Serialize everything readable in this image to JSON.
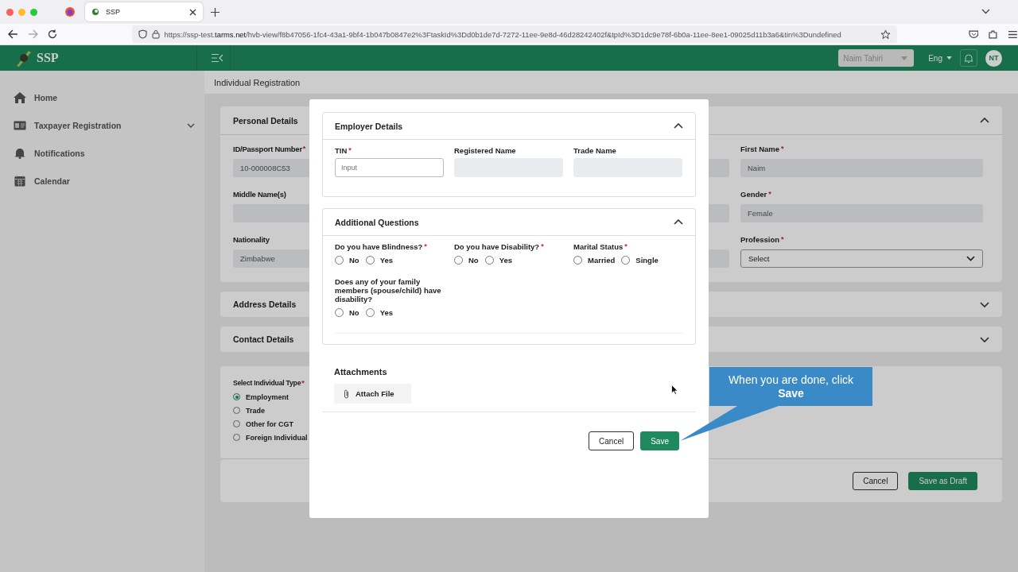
{
  "browser": {
    "tabs": [
      {
        "title": "SSP",
        "selected": true
      }
    ],
    "url": "https://ssp-test.**tarms.net**/hvb-view/f8b47056-1fc4-43a1-9bf4-1b047b0847e2%3FtaskId%3Dd0b1de7d-7272-11ee-9e8d-46d28242402f&tpId%3D1dc9e78f-6b0a-11ee-8ee1-09025d11b3a6&tin%3Dundefined"
  },
  "header": {
    "logo": "SSP",
    "user": "Naim Tahiri",
    "language": "Eng",
    "avatar": "NT"
  },
  "sidebar": {
    "items": [
      {
        "label": "Home"
      },
      {
        "label": "Taxpayer Registration",
        "expanded": false
      },
      {
        "label": "Notifications"
      },
      {
        "label": "Calendar"
      }
    ]
  },
  "page_title": "Individual Registration",
  "personal_details": {
    "title": "Personal Details",
    "expanded": true,
    "left_fields": [
      {
        "label": "ID/Passport Number",
        "required_mark": "*",
        "value": "10-000008C53",
        "kind": "text"
      },
      {
        "label": "Middle Name(s)",
        "kind": "text"
      },
      {
        "label": "Nationality",
        "value": "Zimbabwe",
        "kind": "text"
      }
    ],
    "right_fields": [
      {
        "label": "First Name",
        "required_mark": "*",
        "value": "Naim",
        "kind": "text"
      },
      {
        "label": "Gender",
        "required_mark": "*",
        "value": "Female",
        "kind": "text"
      },
      {
        "label": "Profession",
        "required_mark": "*",
        "value": "Select",
        "kind": "select"
      }
    ]
  },
  "collapsed_sections": [
    {
      "title": "Address Details",
      "expanded": false
    },
    {
      "title": "Contact Details",
      "expanded": false
    }
  ],
  "individual_type": {
    "label": "Select Individual Type",
    "required_mark": "*",
    "options": [
      {
        "label": "Employment",
        "selected": true
      },
      {
        "label": "Trade",
        "selected": false
      },
      {
        "label": "Other for CGT",
        "selected": false
      },
      {
        "label": "Foreign Individual",
        "selected": false
      }
    ]
  },
  "footer_buttons": [
    {
      "label": "Cancel",
      "kind": "secondary"
    },
    {
      "label": "Save as Draft",
      "kind": "primary"
    }
  ],
  "modal": {
    "employer_details": {
      "title": "Employer Details",
      "expanded": true,
      "fields": [
        {
          "label": "TIN",
          "required_mark": "*",
          "placeholder": "Input",
          "disabled": false
        },
        {
          "label": "Registered Name",
          "disabled": true
        },
        {
          "label": "Trade Name",
          "disabled": true
        }
      ]
    },
    "additional_questions": {
      "title": "Additional Questions",
      "expanded": true,
      "questions": [
        {
          "label": "Do you have Blindness?",
          "required_mark": "*",
          "options": [
            {
              "label": "No",
              "selected": false
            },
            {
              "label": "Yes",
              "selected": false
            }
          ]
        },
        {
          "label": "Do you have Disability?",
          "required_mark": "*",
          "options": [
            {
              "label": "No",
              "selected": false
            },
            {
              "label": "Yes",
              "selected": false
            }
          ]
        },
        {
          "label": "Marital Status",
          "required_mark": "*",
          "options": [
            {
              "label": "Married",
              "selected": false
            },
            {
              "label": "Single",
              "selected": false
            }
          ]
        },
        {
          "label": "Does any of your family members (spouse/child) have disability?",
          "options": [
            {
              "label": "No",
              "selected": false
            },
            {
              "label": "Yes",
              "selected": false
            }
          ]
        }
      ]
    },
    "attachments": {
      "title": "Attachments",
      "button": "Attach File"
    },
    "buttons": [
      {
        "label": "Cancel",
        "kind": "secondary"
      },
      {
        "label": "Save",
        "kind": "primary"
      }
    ]
  },
  "callout": "When you are done, click **Save**"
}
